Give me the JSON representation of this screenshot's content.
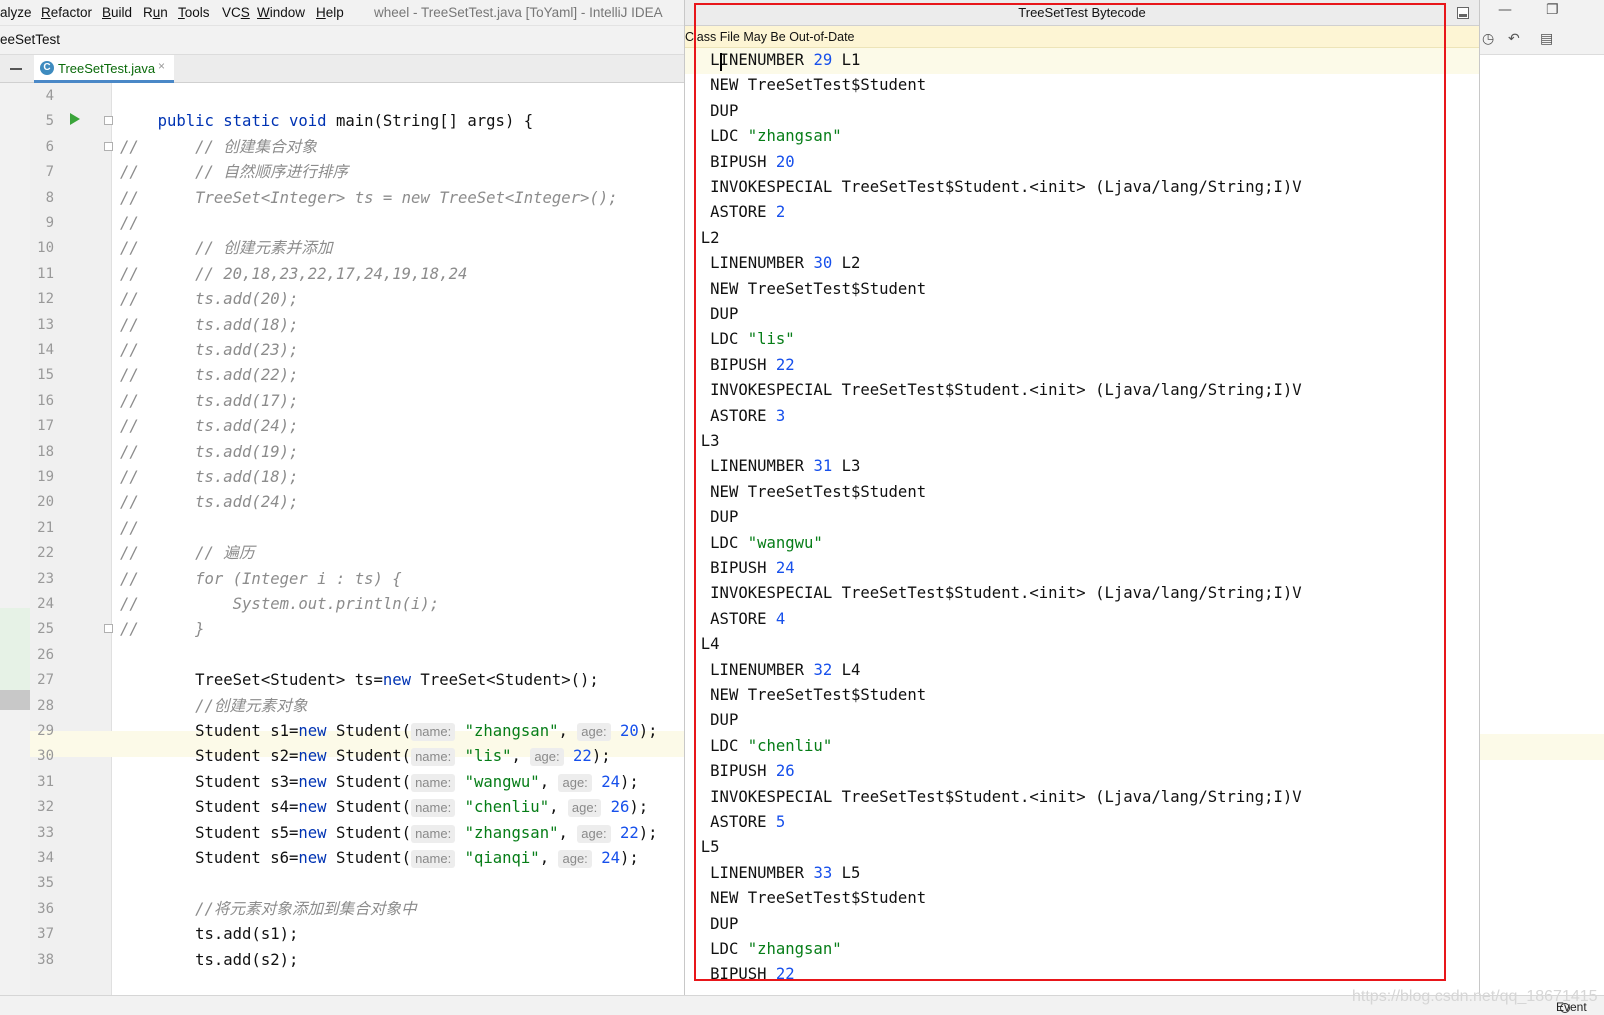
{
  "menu": {
    "items": [
      {
        "label": "alyze",
        "mnemonic": ""
      },
      {
        "label": "Refactor",
        "mnemonic": "R"
      },
      {
        "label": "Build",
        "mnemonic": "B"
      },
      {
        "label": "Run",
        "mnemonic": "u"
      },
      {
        "label": "Tools",
        "mnemonic": "T"
      },
      {
        "label": "VCS",
        "mnemonic": "S"
      },
      {
        "label": "Window",
        "mnemonic": "W"
      },
      {
        "label": "Help",
        "mnemonic": "H"
      }
    ],
    "window_title": "wheel - TreeSetTest.java [ToYaml] - IntelliJ IDEA"
  },
  "nav": {
    "breadcrumb": "eeSetTest"
  },
  "tabs": {
    "active": "TreeSetTest.java",
    "active_icon": "C",
    "close_glyph": "×"
  },
  "editor": {
    "lines": [
      {
        "n": "4",
        "tokens": []
      },
      {
        "n": "5",
        "tokens": [
          {
            "t": "    "
          },
          {
            "t": "public static void ",
            "c": "kw"
          },
          {
            "t": "main(String[] args) {"
          }
        ]
      },
      {
        "n": "6",
        "tokens": [
          {
            "t": "//      // 创建集合对象",
            "c": "cm"
          }
        ]
      },
      {
        "n": "7",
        "tokens": [
          {
            "t": "//      // 自然顺序进行排序",
            "c": "cm"
          }
        ]
      },
      {
        "n": "8",
        "tokens": [
          {
            "t": "//      TreeSet<Integer> ts = new TreeSet<Integer>();",
            "c": "cm"
          }
        ]
      },
      {
        "n": "9",
        "tokens": [
          {
            "t": "//",
            "c": "cm"
          }
        ]
      },
      {
        "n": "10",
        "tokens": [
          {
            "t": "//      // 创建元素并添加",
            "c": "cm"
          }
        ]
      },
      {
        "n": "11",
        "tokens": [
          {
            "t": "//      // 20,18,23,22,17,24,19,18,24",
            "c": "cm"
          }
        ]
      },
      {
        "n": "12",
        "tokens": [
          {
            "t": "//      ts.add(20);",
            "c": "cm"
          }
        ]
      },
      {
        "n": "13",
        "tokens": [
          {
            "t": "//      ts.add(18);",
            "c": "cm"
          }
        ]
      },
      {
        "n": "14",
        "tokens": [
          {
            "t": "//      ts.add(23);",
            "c": "cm"
          }
        ]
      },
      {
        "n": "15",
        "tokens": [
          {
            "t": "//      ts.add(22);",
            "c": "cm"
          }
        ]
      },
      {
        "n": "16",
        "tokens": [
          {
            "t": "//      ts.add(17);",
            "c": "cm"
          }
        ]
      },
      {
        "n": "17",
        "tokens": [
          {
            "t": "//      ts.add(24);",
            "c": "cm"
          }
        ]
      },
      {
        "n": "18",
        "tokens": [
          {
            "t": "//      ts.add(19);",
            "c": "cm"
          }
        ]
      },
      {
        "n": "19",
        "tokens": [
          {
            "t": "//      ts.add(18);",
            "c": "cm"
          }
        ]
      },
      {
        "n": "20",
        "tokens": [
          {
            "t": "//      ts.add(24);",
            "c": "cm"
          }
        ]
      },
      {
        "n": "21",
        "tokens": [
          {
            "t": "//",
            "c": "cm"
          }
        ]
      },
      {
        "n": "22",
        "tokens": [
          {
            "t": "//      // 遍历",
            "c": "cm"
          }
        ]
      },
      {
        "n": "23",
        "tokens": [
          {
            "t": "//      for (Integer i : ts) {",
            "c": "cm"
          }
        ]
      },
      {
        "n": "24",
        "tokens": [
          {
            "t": "//          System.out.println(i);",
            "c": "cm"
          }
        ]
      },
      {
        "n": "25",
        "tokens": [
          {
            "t": "//      }",
            "c": "cm"
          }
        ]
      },
      {
        "n": "26",
        "tokens": []
      },
      {
        "n": "27",
        "tokens": [
          {
            "t": "        TreeSet<Student> ts="
          },
          {
            "t": "new",
            "c": "kw"
          },
          {
            "t": " TreeSet<Student>();"
          }
        ]
      },
      {
        "n": "28",
        "tokens": [
          {
            "t": "        "
          },
          {
            "t": "//创建元素对象",
            "c": "cm"
          }
        ]
      },
      {
        "n": "29",
        "tokens": [
          {
            "t": "        Student s1="
          },
          {
            "t": "new",
            "c": "kw"
          },
          {
            "t": " Student("
          },
          {
            "t": "name:",
            "c": "hint"
          },
          {
            "t": " "
          },
          {
            "t": "\"zhangsan\"",
            "c": "st"
          },
          {
            "t": ", "
          },
          {
            "t": "age:",
            "c": "hint"
          },
          {
            "t": " "
          },
          {
            "t": "20",
            "c": "nm"
          },
          {
            "t": ");"
          }
        ]
      },
      {
        "n": "30",
        "tokens": [
          {
            "t": "        Student s2="
          },
          {
            "t": "new",
            "c": "kw"
          },
          {
            "t": " Student("
          },
          {
            "t": "name:",
            "c": "hint"
          },
          {
            "t": " "
          },
          {
            "t": "\"lis\"",
            "c": "st"
          },
          {
            "t": ", "
          },
          {
            "t": "age:",
            "c": "hint"
          },
          {
            "t": " "
          },
          {
            "t": "22",
            "c": "nm"
          },
          {
            "t": ");"
          }
        ]
      },
      {
        "n": "31",
        "tokens": [
          {
            "t": "        Student s3="
          },
          {
            "t": "new",
            "c": "kw"
          },
          {
            "t": " Student("
          },
          {
            "t": "name:",
            "c": "hint"
          },
          {
            "t": " "
          },
          {
            "t": "\"wangwu\"",
            "c": "st"
          },
          {
            "t": ", "
          },
          {
            "t": "age:",
            "c": "hint"
          },
          {
            "t": " "
          },
          {
            "t": "24",
            "c": "nm"
          },
          {
            "t": ");"
          }
        ]
      },
      {
        "n": "32",
        "tokens": [
          {
            "t": "        Student s4="
          },
          {
            "t": "new",
            "c": "kw"
          },
          {
            "t": " Student("
          },
          {
            "t": "name:",
            "c": "hint"
          },
          {
            "t": " "
          },
          {
            "t": "\"chenliu\"",
            "c": "st"
          },
          {
            "t": ", "
          },
          {
            "t": "age:",
            "c": "hint"
          },
          {
            "t": " "
          },
          {
            "t": "26",
            "c": "nm"
          },
          {
            "t": ");"
          }
        ]
      },
      {
        "n": "33",
        "tokens": [
          {
            "t": "        Student s5="
          },
          {
            "t": "new",
            "c": "kw"
          },
          {
            "t": " Student("
          },
          {
            "t": "name:",
            "c": "hint"
          },
          {
            "t": " "
          },
          {
            "t": "\"zhangsan\"",
            "c": "st"
          },
          {
            "t": ", "
          },
          {
            "t": "age:",
            "c": "hint"
          },
          {
            "t": " "
          },
          {
            "t": "22",
            "c": "nm"
          },
          {
            "t": ");"
          }
        ]
      },
      {
        "n": "34",
        "tokens": [
          {
            "t": "        Student s6="
          },
          {
            "t": "new",
            "c": "kw"
          },
          {
            "t": " Student("
          },
          {
            "t": "name:",
            "c": "hint"
          },
          {
            "t": " "
          },
          {
            "t": "\"qianqi\"",
            "c": "st"
          },
          {
            "t": ", "
          },
          {
            "t": "age:",
            "c": "hint"
          },
          {
            "t": " "
          },
          {
            "t": "24",
            "c": "nm"
          },
          {
            "t": ");"
          }
        ]
      },
      {
        "n": "35",
        "tokens": []
      },
      {
        "n": "36",
        "tokens": [
          {
            "t": "        "
          },
          {
            "t": "//将元素对象添加到集合对象中",
            "c": "cm"
          }
        ]
      },
      {
        "n": "37",
        "tokens": [
          {
            "t": "        ts.add(s1);"
          }
        ]
      },
      {
        "n": "38",
        "tokens": [
          {
            "t": "        ts.add(s2);"
          }
        ]
      }
    ]
  },
  "bytecode": {
    "title": "TreeSetTest Bytecode",
    "banner": "Class File May Be Out-of-Date",
    "lines": [
      [
        {
          "t": "   LINENUMBER "
        },
        {
          "t": "29",
          "c": "n"
        },
        {
          "t": " L1"
        }
      ],
      [
        {
          "t": "   NEW TreeSetTest$Student"
        }
      ],
      [
        {
          "t": "   DUP"
        }
      ],
      [
        {
          "t": "   LDC "
        },
        {
          "t": "\"zhangsan\"",
          "c": "s"
        }
      ],
      [
        {
          "t": "   BIPUSH "
        },
        {
          "t": "20",
          "c": "n"
        }
      ],
      [
        {
          "t": "   INVOKESPECIAL TreeSetTest$Student.<init> (Ljava/lang/String;I)V"
        }
      ],
      [
        {
          "t": "   ASTORE "
        },
        {
          "t": "2",
          "c": "n"
        }
      ],
      [
        {
          "t": "  L2"
        }
      ],
      [
        {
          "t": "   LINENUMBER "
        },
        {
          "t": "30",
          "c": "n"
        },
        {
          "t": " L2"
        }
      ],
      [
        {
          "t": "   NEW TreeSetTest$Student"
        }
      ],
      [
        {
          "t": "   DUP"
        }
      ],
      [
        {
          "t": "   LDC "
        },
        {
          "t": "\"lis\"",
          "c": "s"
        }
      ],
      [
        {
          "t": "   BIPUSH "
        },
        {
          "t": "22",
          "c": "n"
        }
      ],
      [
        {
          "t": "   INVOKESPECIAL TreeSetTest$Student.<init> (Ljava/lang/String;I)V"
        }
      ],
      [
        {
          "t": "   ASTORE "
        },
        {
          "t": "3",
          "c": "n"
        }
      ],
      [
        {
          "t": "  L3"
        }
      ],
      [
        {
          "t": "   LINENUMBER "
        },
        {
          "t": "31",
          "c": "n"
        },
        {
          "t": " L3"
        }
      ],
      [
        {
          "t": "   NEW TreeSetTest$Student"
        }
      ],
      [
        {
          "t": "   DUP"
        }
      ],
      [
        {
          "t": "   LDC "
        },
        {
          "t": "\"wangwu\"",
          "c": "s"
        }
      ],
      [
        {
          "t": "   BIPUSH "
        },
        {
          "t": "24",
          "c": "n"
        }
      ],
      [
        {
          "t": "   INVOKESPECIAL TreeSetTest$Student.<init> (Ljava/lang/String;I)V"
        }
      ],
      [
        {
          "t": "   ASTORE "
        },
        {
          "t": "4",
          "c": "n"
        }
      ],
      [
        {
          "t": "  L4"
        }
      ],
      [
        {
          "t": "   LINENUMBER "
        },
        {
          "t": "32",
          "c": "n"
        },
        {
          "t": " L4"
        }
      ],
      [
        {
          "t": "   NEW TreeSetTest$Student"
        }
      ],
      [
        {
          "t": "   DUP"
        }
      ],
      [
        {
          "t": "   LDC "
        },
        {
          "t": "\"chenliu\"",
          "c": "s"
        }
      ],
      [
        {
          "t": "   BIPUSH "
        },
        {
          "t": "26",
          "c": "n"
        }
      ],
      [
        {
          "t": "   INVOKESPECIAL TreeSetTest$Student.<init> (Ljava/lang/String;I)V"
        }
      ],
      [
        {
          "t": "   ASTORE "
        },
        {
          "t": "5",
          "c": "n"
        }
      ],
      [
        {
          "t": "  L5"
        }
      ],
      [
        {
          "t": "   LINENUMBER "
        },
        {
          "t": "33",
          "c": "n"
        },
        {
          "t": " L5"
        }
      ],
      [
        {
          "t": "   NEW TreeSetTest$Student"
        }
      ],
      [
        {
          "t": "   DUP"
        }
      ],
      [
        {
          "t": "   LDC "
        },
        {
          "t": "\"zhangsan\"",
          "c": "s"
        }
      ],
      [
        {
          "t": "   BIPUSH "
        },
        {
          "t": "22",
          "c": "n"
        }
      ]
    ]
  },
  "status": {
    "watermark": "https://blog.csdn.net/qq_18671415",
    "event_log": "Event"
  },
  "colors": {
    "annotation_frame": "#e8161a",
    "keyword": "#0033b3",
    "string": "#067d17",
    "number": "#1750eb",
    "comment": "#8c8c8c"
  }
}
